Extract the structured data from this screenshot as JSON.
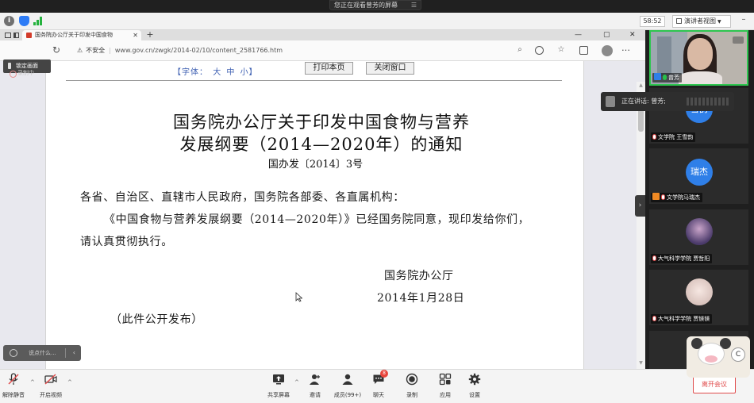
{
  "meeting": {
    "sharing_banner": "您正在观看曾芳的屏幕",
    "timer": "58:52",
    "view_button": "演讲者视图",
    "speaking_indicator": "正在讲话: 曾芳;",
    "leave_button": "离开会议",
    "chat_placeholder": "说点什么...",
    "pin_tooltip": "锁定画面",
    "record_label": "录制中"
  },
  "browser": {
    "tab_title": "国务院办公厅关于印发中国食物",
    "insecure_label": "不安全",
    "url": "www.gov.cn/zwgk/2014-02/10/content_2581766.htm"
  },
  "document": {
    "font_size_label": "【字体：",
    "font_large": "大",
    "font_medium": "中",
    "font_small": "小】",
    "print_button": "打印本页",
    "close_button": "关闭窗口",
    "title_line1": "国务院办公厅关于印发中国食物与营养",
    "title_line2": "发展纲要（2014—2020年）的通知",
    "doc_number": "国办发〔2014〕3号",
    "salutation": "各省、自治区、直辖市人民政府，国务院各部委、各直属机构：",
    "para_line1": "《中国食物与营养发展纲要（2014—2020年）》已经国务院同意，现印发给你们，",
    "para_line2": "请认真贯彻执行。",
    "issuer": "国务院办公厅",
    "date": "2014年1月28日",
    "publish_note": "（此件公开发布）"
  },
  "participants": [
    {
      "name": "曾芳",
      "mic": "on",
      "host": true
    },
    {
      "name": "文学院 王雪韵",
      "avatar_text": "雪韵",
      "avatar_color": "#2f7fe8",
      "mic": "off"
    },
    {
      "name": "文学院马瑞杰",
      "avatar_text": "瑞杰",
      "avatar_color": "#2f7fe8",
      "mic": "off",
      "host": true
    },
    {
      "name": "大气科学学院 贾哲阳",
      "mic": "off"
    },
    {
      "name": "大气科学学院 贾镁镁",
      "mic": "off"
    }
  ],
  "mascot_badge": "C",
  "toolbar": {
    "mute": "解除静音",
    "video": "开启视频",
    "share": "共享屏幕",
    "invite": "邀请",
    "members": "成员(99+)",
    "chat": "聊天",
    "chat_badge": "8",
    "record": "录制",
    "apps": "应用",
    "settings": "设置"
  },
  "colors": {
    "active_speaker_border": "#2ec650",
    "leave_red": "#e04b4b",
    "avatar_blue": "#2f7fe8",
    "doc_link_blue": "#3d5fb2"
  }
}
